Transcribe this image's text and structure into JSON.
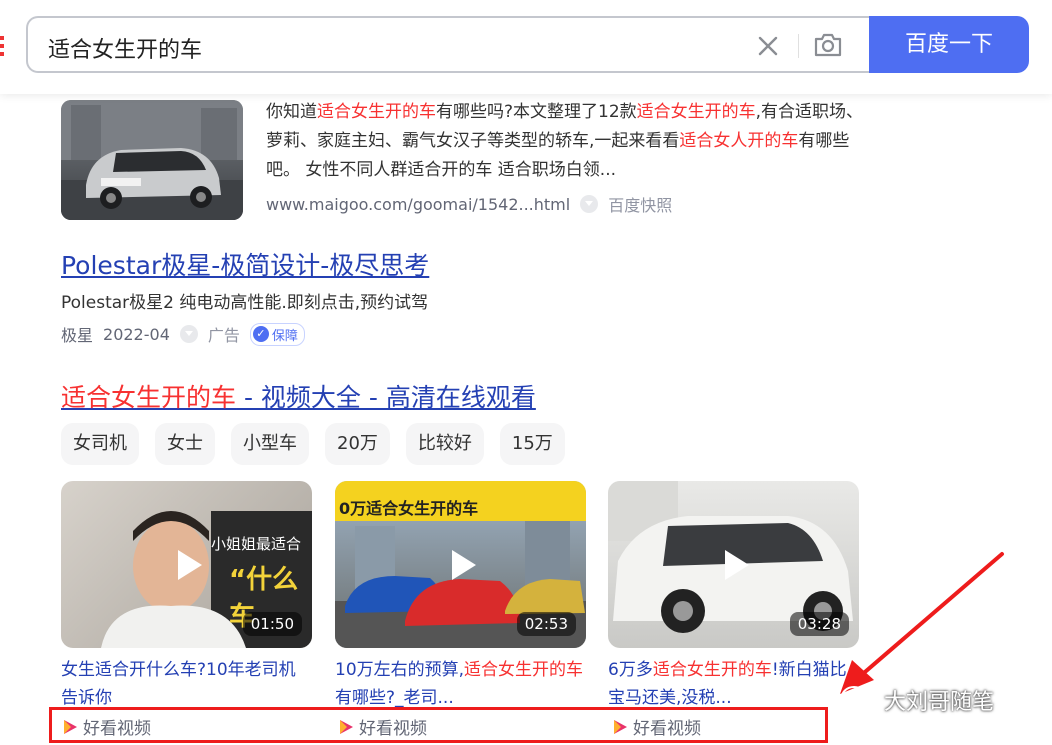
{
  "search": {
    "query": "适合女生开的车",
    "button_label": "百度一下"
  },
  "result1": {
    "text_parts": [
      {
        "t": "你知道",
        "hl": false
      },
      {
        "t": "适合女生开的车",
        "hl": true
      },
      {
        "t": "有哪些吗?本文整理了12款",
        "hl": false
      },
      {
        "t": "适合女生开的车",
        "hl": true
      },
      {
        "t": ",有合适职场、萝莉、家庭主妇、霸气女汉子等类型的轿车,一起来看看",
        "hl": false
      },
      {
        "t": "适合女人开的车",
        "hl": true
      },
      {
        "t": "有哪些吧。 女性不同人群适合开的车 适合职场白领...",
        "hl": false
      }
    ],
    "url": "www.maigoo.com/goomai/1542...html",
    "cache_label": "百度快照"
  },
  "ad": {
    "title": "Polestar极星-极简设计-极尽思考",
    "desc": "Polestar极星2 纯电动高性能.即刻点击,预约试驾",
    "source": "极星",
    "date": "2022-04",
    "ad_label": "广告",
    "badge": "保障"
  },
  "videos": {
    "title_hl": "适合女生开的车",
    "title_rest": " - 视频大全 - 高清在线观看",
    "tags": [
      "女司机",
      "女士",
      "小型车",
      "20万",
      "比较好",
      "15万"
    ],
    "items": [
      {
        "parts": [
          {
            "t": "女生适合开什么车?10年老司机告诉你",
            "hl": false
          }
        ],
        "duration": "01:50",
        "source": "好看视频",
        "overlay": "小姐姐最适合",
        "overlay2": "“什么车"
      },
      {
        "parts": [
          {
            "t": "10万左右的预算,",
            "hl": false
          },
          {
            "t": "适合女生开的车",
            "hl": true
          },
          {
            "t": "有哪些?_老司...",
            "hl": false
          }
        ],
        "duration": "02:53",
        "source": "好看视频",
        "overlay": "0万适合女生开的车"
      },
      {
        "parts": [
          {
            "t": "6万多",
            "hl": false
          },
          {
            "t": "适合女生开的车",
            "hl": true
          },
          {
            "t": "!新白猫比宝马还美,没税...",
            "hl": false
          }
        ],
        "duration": "03:28",
        "source": "好看视频"
      }
    ]
  },
  "watermark": "大刘哥随笔",
  "colors": {
    "link": "#2440b3",
    "highlight": "#f73131",
    "brand": "#4e6ef2",
    "annotation": "#ee1c1c"
  }
}
